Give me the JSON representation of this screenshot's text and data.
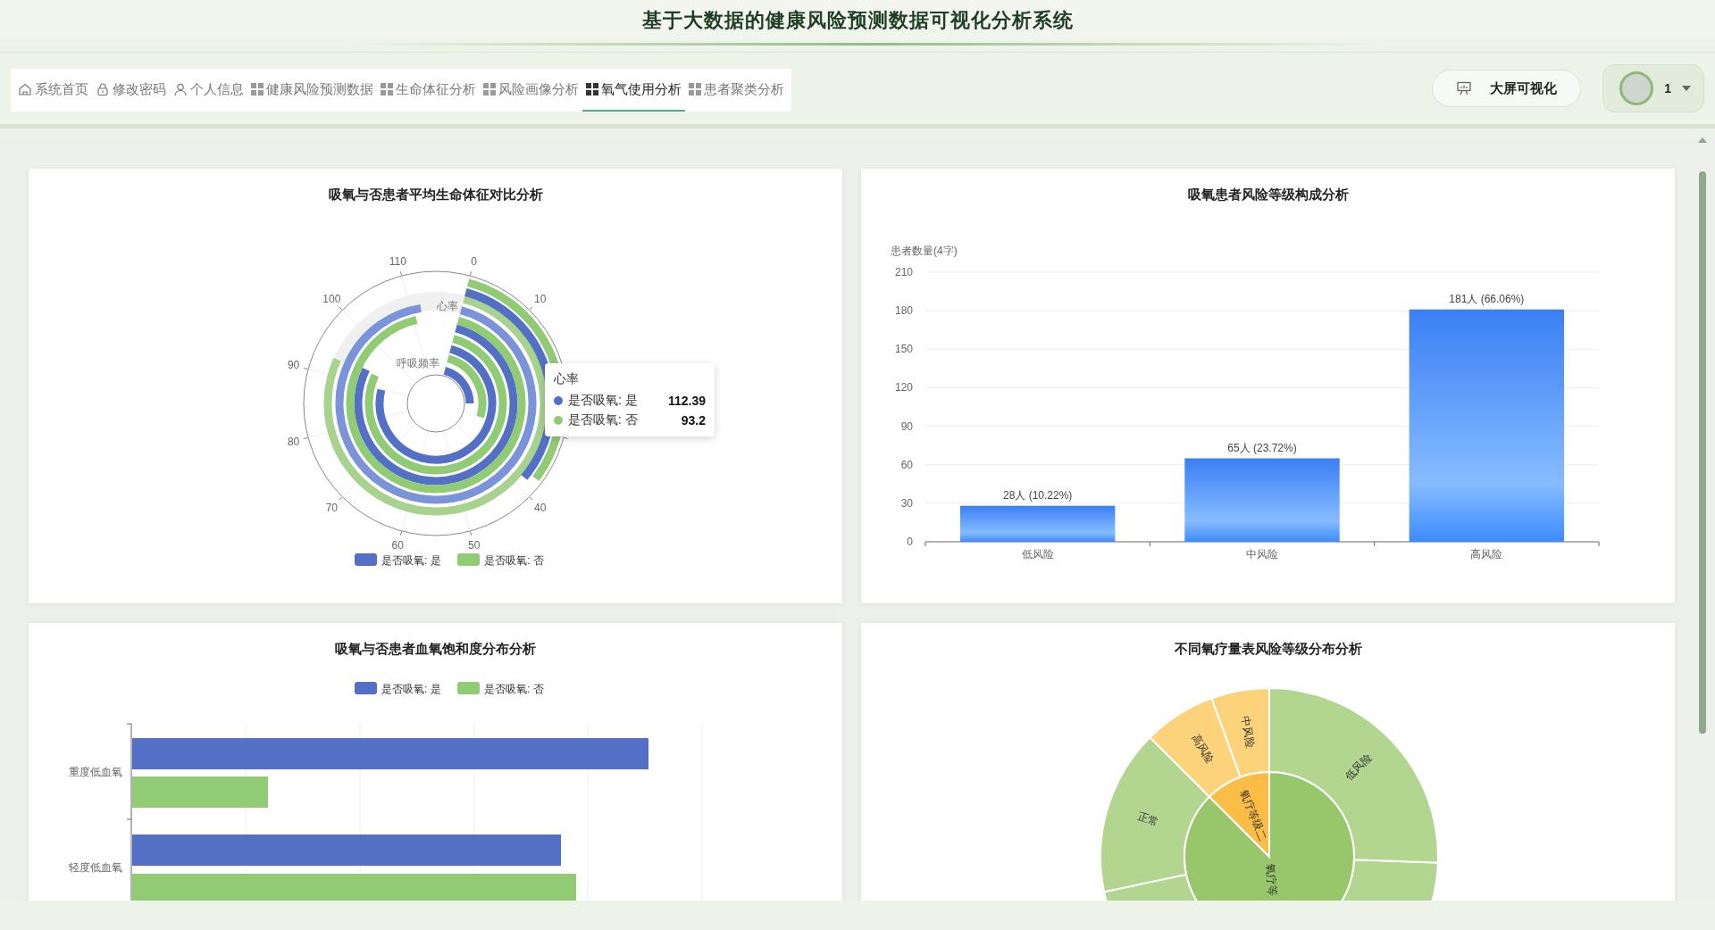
{
  "header": {
    "title": "基于大数据的健康风险预测数据可视化分析系统"
  },
  "nav": {
    "tabs": [
      {
        "label": "系统首页",
        "kind": "home",
        "selected": false
      },
      {
        "label": "修改密码",
        "kind": "lock",
        "selected": false
      },
      {
        "label": "个人信息",
        "kind": "person",
        "selected": false
      },
      {
        "label": "健康风险预测数据",
        "kind": "grid",
        "selected": false
      },
      {
        "label": "生命体征分析",
        "kind": "grid",
        "selected": false
      },
      {
        "label": "风险画像分析",
        "kind": "grid",
        "selected": false
      },
      {
        "label": "氧气使用分析",
        "kind": "grid",
        "selected": true
      },
      {
        "label": "患者聚类分析",
        "kind": "grid",
        "selected": false
      }
    ]
  },
  "actions": {
    "screen_button": "大屏可视化",
    "user": {
      "name": "1"
    }
  },
  "charts": [
    {
      "kind": "polar",
      "title": "吸氧与否患者平均生命体征对比分析",
      "angle_ticks": [
        "110",
        "0",
        "10",
        "40",
        "50",
        "60",
        "70",
        "80",
        "90",
        "100"
      ],
      "category_labels": [
        "心率",
        "呼吸频率"
      ],
      "tooltip": {
        "title": "心率",
        "rows": [
          {
            "label": "是否吸氧: 是",
            "value": "112.39",
            "color": "#5470c6"
          },
          {
            "label": "是否吸氧: 否",
            "value": "93.2",
            "color": "#91cc75"
          }
        ]
      },
      "legend": [
        {
          "label": "是否吸氧: 是",
          "color": "#5470c6"
        },
        {
          "label": "是否吸氧: 否",
          "color": "#91cc75"
        }
      ]
    },
    {
      "kind": "bar",
      "title": "吸氧患者风险等级构成分析",
      "chart_data": {
        "type": "bar",
        "ylabel": "患者数量(4字)",
        "categories": [
          "低风险",
          "中风险",
          "高风险"
        ],
        "series": [
          {
            "color": "#3a7ff5",
            "values": [
              28,
              65,
              181
            ]
          }
        ],
        "grid": true,
        "ylim": [
          0,
          210
        ],
        "yticks": [
          0,
          30,
          60,
          90,
          120,
          150,
          180,
          210
        ],
        "value_labels": [
          "28人 (10.22%)",
          "65人 (23.72%)",
          "181人 (66.06%)"
        ]
      }
    },
    {
      "kind": "hbar",
      "title": "吸氧与否患者血氧饱和度分布分析",
      "legend": [
        {
          "label": "是否吸氧: 是",
          "color": "#5470c6"
        },
        {
          "label": "是否吸氧: 否",
          "color": "#91cc75"
        }
      ],
      "y_labels": [
        "重度低血氧",
        "轻度低血氧"
      ]
    },
    {
      "kind": "sunburst",
      "title": "不同氧疗量表风险等级分布分析",
      "outer": [
        {
          "label": "中风险",
          "color": "#fcd27a"
        },
        {
          "label": "高风险",
          "color": "#fcd27a"
        },
        {
          "label": "正常",
          "color": "#b2d590"
        },
        {
          "label": "低风险",
          "color": "#b2d590"
        }
      ],
      "inner": [
        {
          "label": "氧疗等级二",
          "color": "#fbbd45"
        },
        {
          "label": "氧疗等",
          "color": "#97c66b"
        }
      ]
    }
  ]
}
